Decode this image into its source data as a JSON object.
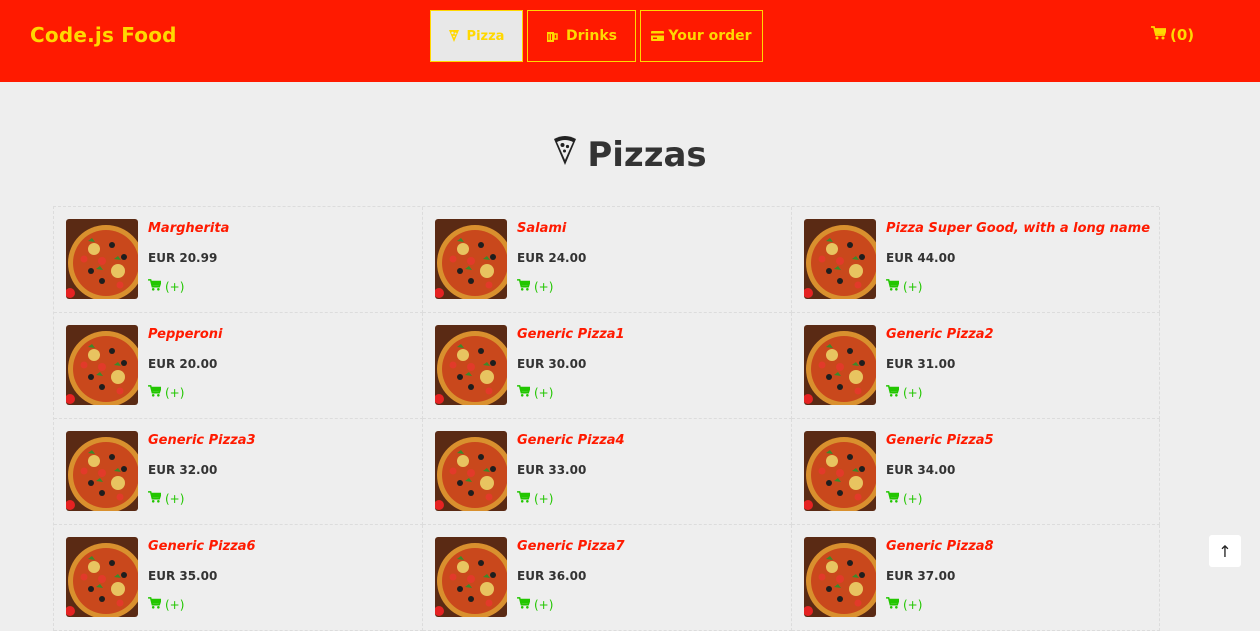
{
  "brand": "Code.js Food",
  "nav": {
    "pizza": "Pizza",
    "drinks": "Drinks",
    "order": "Your order"
  },
  "cart_count": "(0)",
  "heading": "Pizzas",
  "add_label": "(+)",
  "scroll_top_label": "↑",
  "colors": {
    "topbar": "#ff1a00",
    "accent_yellow": "#ffd800",
    "name_red": "#ff1a00",
    "add_green": "#22c600",
    "page_bg": "#eeeeee"
  },
  "products": [
    {
      "name": "Margherita",
      "price": "EUR 20.99"
    },
    {
      "name": "Salami",
      "price": "EUR 24.00"
    },
    {
      "name": "Pizza Super Good, with a long name",
      "price": "EUR 44.00"
    },
    {
      "name": "Pepperoni",
      "price": "EUR 20.00"
    },
    {
      "name": "Generic Pizza1",
      "price": "EUR 30.00"
    },
    {
      "name": "Generic Pizza2",
      "price": "EUR 31.00"
    },
    {
      "name": "Generic Pizza3",
      "price": "EUR 32.00"
    },
    {
      "name": "Generic Pizza4",
      "price": "EUR 33.00"
    },
    {
      "name": "Generic Pizza5",
      "price": "EUR 34.00"
    },
    {
      "name": "Generic Pizza6",
      "price": "EUR 35.00"
    },
    {
      "name": "Generic Pizza7",
      "price": "EUR 36.00"
    },
    {
      "name": "Generic Pizza8",
      "price": "EUR 37.00"
    }
  ]
}
